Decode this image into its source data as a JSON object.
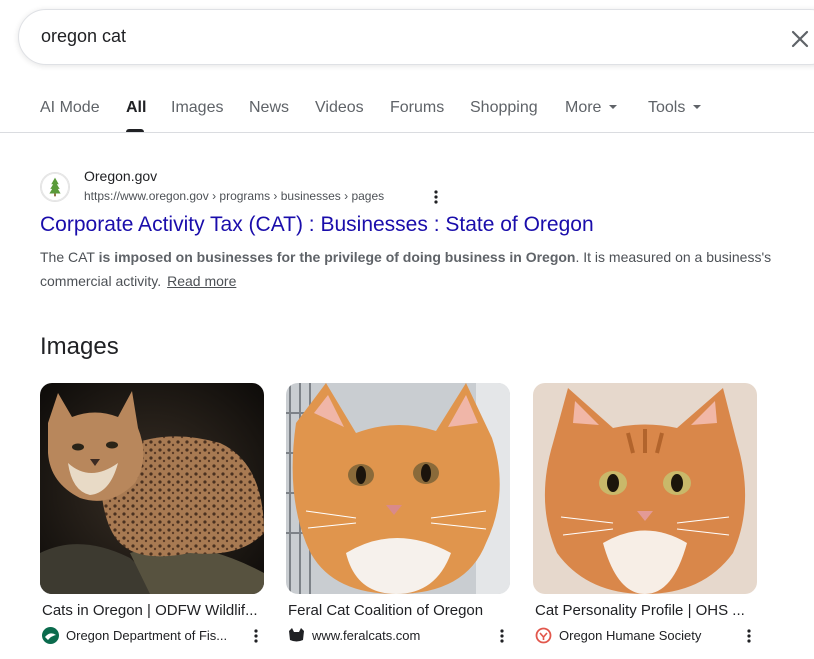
{
  "search": {
    "query": "oregon cat"
  },
  "tabs": [
    {
      "label": "AI Mode"
    },
    {
      "label": "All"
    },
    {
      "label": "Images"
    },
    {
      "label": "News"
    },
    {
      "label": "Videos"
    },
    {
      "label": "Forums"
    },
    {
      "label": "Shopping"
    },
    {
      "label": "More"
    },
    {
      "label": "Tools"
    }
  ],
  "result": {
    "site_name": "Oregon.gov",
    "url": "https://www.oregon.gov › programs › businesses › pages",
    "title": "Corporate Activity Tax (CAT) : Businesses : State of Oregon",
    "snippet_start": "The CAT ",
    "snippet_bold": "is imposed on businesses for the privilege of doing business in Oregon",
    "snippet_end": ". It is measured on a business's commercial activity.",
    "read_more": "Read more"
  },
  "images_section": {
    "heading": "Images",
    "cards": [
      {
        "title": "Cats in Oregon | ODFW Wildlif...",
        "source": "Oregon Department of Fis...",
        "icon": "odfw-logo-icon"
      },
      {
        "title": "Feral Cat Coalition of Oregon",
        "source": "www.feralcats.com",
        "icon": "cat-silhouette-icon"
      },
      {
        "title": "Cat Personality Profile | OHS ...",
        "source": "Oregon Humane Society",
        "icon": "ohs-logo-icon"
      }
    ]
  },
  "colors": {
    "link": "#1a0dab",
    "tab_active": "#202124",
    "tab_inactive": "#5f6368",
    "snippet": "#4d5156"
  }
}
